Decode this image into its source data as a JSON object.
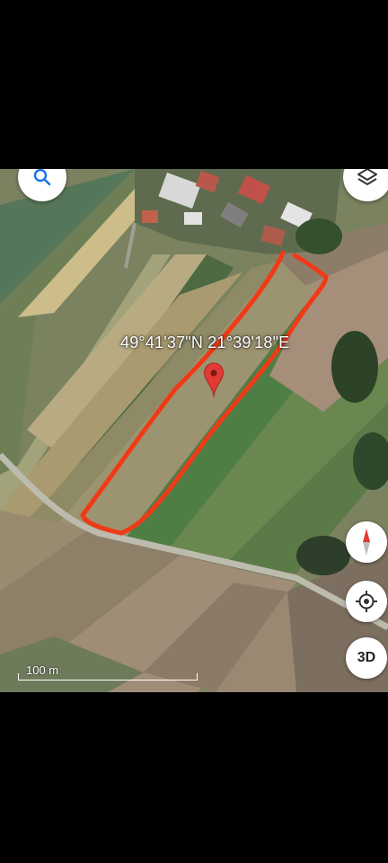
{
  "coordinates": "49°41'37\"N 21°39'18\"E",
  "scale_label": "100 m",
  "buttons": {
    "search_icon": "search-icon",
    "layers_icon": "layers-icon",
    "compass_icon": "compass-icon",
    "locate_icon": "my-location-icon",
    "three_d_label": "3D"
  },
  "colors": {
    "outline": "#f03a17",
    "pin": "#e53935",
    "accent_blue": "#1a73e8"
  }
}
